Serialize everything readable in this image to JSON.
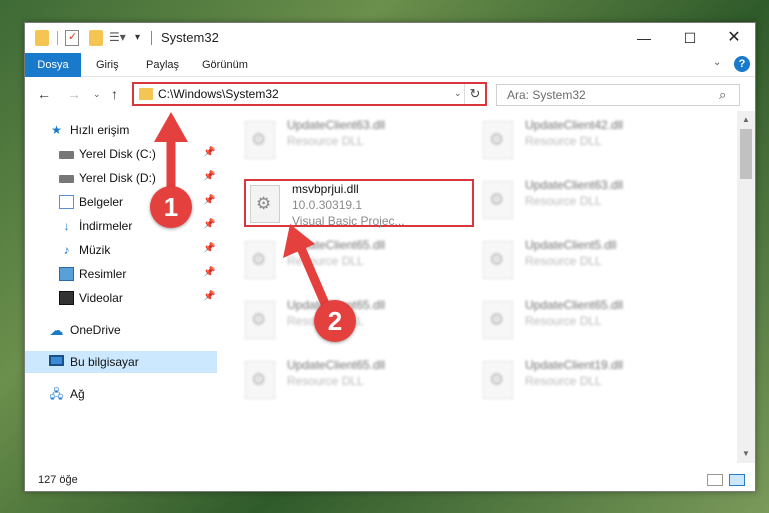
{
  "window": {
    "title": "System32",
    "min_symbol": "—",
    "max_symbol": "☐",
    "close_symbol": "✕"
  },
  "ribbon": {
    "tabs": [
      "Dosya",
      "Giriş",
      "Paylaş",
      "Görünüm"
    ],
    "help": "?"
  },
  "nav": {
    "address": "C:\\Windows\\System32",
    "search_placeholder": "Ara: System32"
  },
  "sidebar": {
    "items": [
      {
        "label": "Hızlı erişim",
        "icon": "star-icon"
      },
      {
        "label": "Yerel Disk (C:)",
        "icon": "drive-icon",
        "pinned": true
      },
      {
        "label": "Yerel Disk (D:)",
        "icon": "drive-icon",
        "pinned": true
      },
      {
        "label": "Belgeler",
        "icon": "documents-icon",
        "pinned": true
      },
      {
        "label": "İndirmeler",
        "icon": "download-icon",
        "pinned": true
      },
      {
        "label": "Müzik",
        "icon": "music-icon",
        "pinned": true
      },
      {
        "label": "Resimler",
        "icon": "pictures-icon",
        "pinned": true
      },
      {
        "label": "Videolar",
        "icon": "videos-icon",
        "pinned": true
      },
      {
        "label": "OneDrive",
        "icon": "onedrive-icon"
      },
      {
        "label": "Bu bilgisayar",
        "icon": "this-pc-icon",
        "selected": true
      },
      {
        "label": "Ağ",
        "icon": "network-icon"
      }
    ]
  },
  "files": {
    "highlighted": {
      "name": "msvbprjui.dll",
      "version": "10.0.30319.1",
      "description": "Visual Basic Projec..."
    },
    "blurred": [
      {
        "name": "UpdateClient63.dll",
        "desc": "Resource DLL"
      },
      {
        "name": "UpdateClient42.dll",
        "desc": "Resource DLL"
      },
      {
        "name": "UpdateClient63.dll",
        "desc": "Resource DLL"
      },
      {
        "name": "UpdateClient5.dll",
        "desc": "Resource DLL"
      },
      {
        "name": "UpdateClient65.dll",
        "desc": "Resource DLL"
      },
      {
        "name": "UpdateClient65.dll",
        "desc": "Resource DLL"
      },
      {
        "name": "UpdateClient65.dll",
        "desc": "Resource DLL"
      },
      {
        "name": "UpdateClient19.dll",
        "desc": "Resource DLL"
      },
      {
        "name": "UpdateClient65.dll",
        "desc": "Resource DLL"
      },
      {
        "name": "UpdateClient65.dll",
        "desc": "Resource DLL"
      }
    ]
  },
  "status": {
    "count": "127 öğe"
  },
  "callouts": {
    "step1": "1",
    "step2": "2",
    "color": "#e4403e"
  },
  "colors": {
    "accent": "#1979ca",
    "highlight_border": "#d9363e",
    "selected_bg": "#cce8ff"
  }
}
